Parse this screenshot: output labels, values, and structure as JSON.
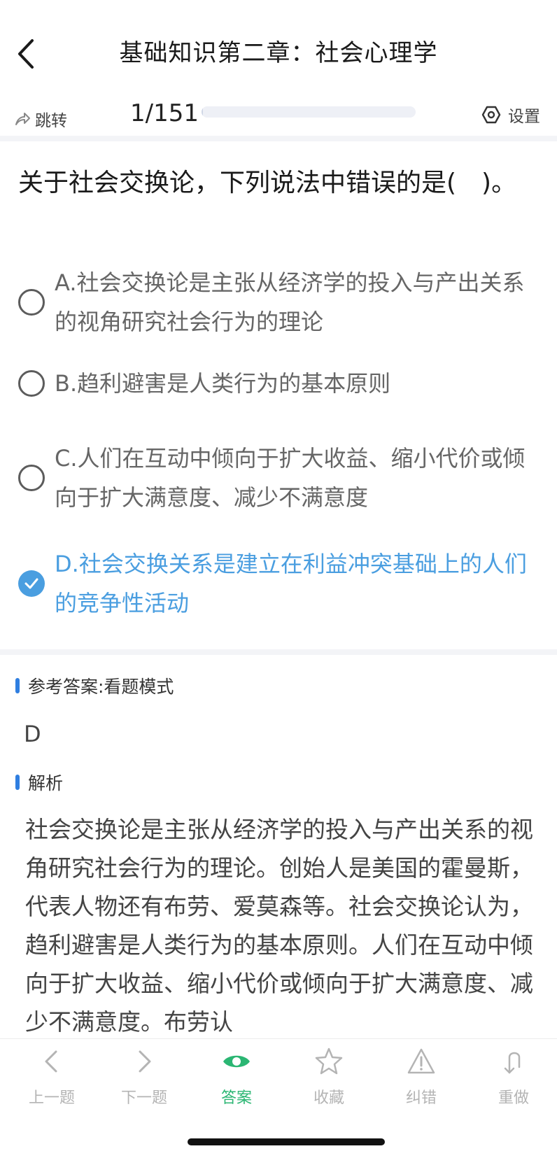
{
  "header": {
    "title": "基础知识第二章：社会心理学"
  },
  "toolbar": {
    "jump_label": "跳转",
    "progress_text": "1/151",
    "progress_fraction": 0.0066,
    "settings_label": "设置"
  },
  "question": {
    "text": "关于社会交换论，下列说法中错误的是(　)。",
    "options": [
      {
        "text": "A.社会交换论是主张从经济学的投入与产出关系的视角研究社会行为的理论",
        "selected": false
      },
      {
        "text": "B.趋利避害是人类行为的基本原则",
        "selected": false
      },
      {
        "text": "C.人们在互动中倾向于扩大收益、缩小代价或倾向于扩大满意度、减少不满意度",
        "selected": false
      },
      {
        "text": "D.社会交换关系是建立在利益冲突基础上的人们的竞争性活动",
        "selected": true
      }
    ]
  },
  "reference": {
    "label": "参考答案:看题模式",
    "answer": "D"
  },
  "analysis": {
    "label": "解析",
    "text": "社会交换论是主张从经济学的投入与产出关系的视角研究社会行为的理论。创始人是美国的霍曼斯，代表人物还有布劳、爱莫森等。社会交换论认为，趋利避害是人类行为的基本原则。人们在互动中倾向于扩大收益、缩小代价或倾向于扩大满意度、减少不满意度。布劳认"
  },
  "bottom_nav": [
    {
      "label": "上一题",
      "icon": "chevron-left-icon"
    },
    {
      "label": "下一题",
      "icon": "chevron-right-icon"
    },
    {
      "label": "答案",
      "icon": "eye-icon",
      "active": true
    },
    {
      "label": "收藏",
      "icon": "star-icon"
    },
    {
      "label": "纠错",
      "icon": "warning-icon"
    },
    {
      "label": "重做",
      "icon": "redo-icon"
    }
  ],
  "colors": {
    "accent_blue": "#4a9ee0",
    "active_green": "#2bb673",
    "section_bar": "#2f7ee0"
  }
}
